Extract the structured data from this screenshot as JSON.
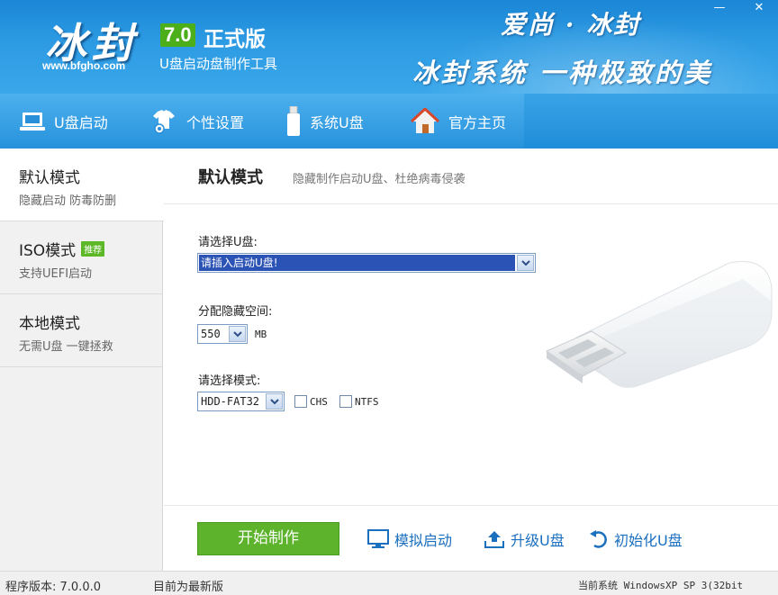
{
  "header": {
    "logo_title": "冰封",
    "logo_url": "www.bfgho.com",
    "version": "7.0",
    "edition": "正式版",
    "subtitle": "U盘启动盘制作工具",
    "slogan_line1": "爱尚 · 冰封",
    "slogan_line2": "冰封系统 一种极致的美",
    "minimize_glyph": "—",
    "close_glyph": "✕"
  },
  "nav": {
    "items": [
      {
        "label": "U盘启动",
        "icon": "laptop-icon"
      },
      {
        "label": "个性设置",
        "icon": "shirt-gear-icon"
      },
      {
        "label": "系统U盘",
        "icon": "usb-drive-icon"
      },
      {
        "label": "官方主页",
        "icon": "home-icon"
      }
    ]
  },
  "sidebar": {
    "items": [
      {
        "title": "默认模式",
        "desc": "隐藏启动 防毒防删",
        "active": true
      },
      {
        "title": "ISO模式",
        "badge": "推荐",
        "desc": "支持UEFI启动"
      },
      {
        "title": "本地模式",
        "desc": "无需U盘 一键拯救"
      }
    ]
  },
  "main": {
    "title": "默认模式",
    "description": "隐藏制作启动U盘、杜绝病毒侵袭",
    "select_usb_label": "请选择U盘:",
    "select_usb_value": "请插入启动U盘!",
    "hidden_space_label": "分配隐藏空间:",
    "hidden_space_value": "550",
    "hidden_space_unit": "MB",
    "mode_label": "请选择模式:",
    "mode_value": "HDD-FAT32",
    "chs_label": "CHS",
    "ntfs_label": "NTFS"
  },
  "actions": {
    "start": "开始制作",
    "simulate": "模拟启动",
    "upgrade": "升级U盘",
    "initialize": "初始化U盘"
  },
  "status": {
    "program_version": "程序版本: 7.0.0.0",
    "update_status": "目前为最新版",
    "current_system": "当前系统 WindowsXP SP 3(32bit"
  },
  "colors": {
    "header_blue": "#1a86d6",
    "accent_green": "#5db42c",
    "link_blue": "#1b6fbf",
    "selection_blue": "#2b52b5"
  }
}
